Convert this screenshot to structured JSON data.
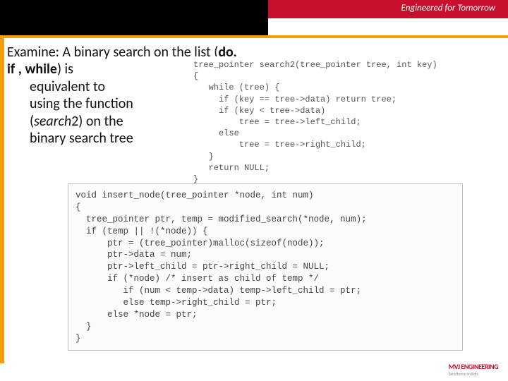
{
  "banner": {
    "tagline": "Engineered for Tomorrow"
  },
  "body": {
    "line1_pre": "Examine: A binary search on the list (",
    "line1_bold": "do, if , while",
    "line1_post": ") is",
    "line2": "equivalent to",
    "line3": "using the function",
    "line4_pre": "(",
    "line4_italic": "search",
    "line4_post": "2) on the",
    "line5": "binary search tree"
  },
  "code1": "tree_pointer search2(tree_pointer tree, int key)\n{\n   while (tree) {\n     if (key == tree->data) return tree;\n     if (key < tree->data)\n         tree = tree->left_child;\n     else\n         tree = tree->right_child;\n   }\n   return NULL;\n}",
  "code2": "void insert_node(tree_pointer *node, int num)\n{\n  tree_pointer ptr, temp = modified_search(*node, num);\n  if (temp || !(*node)) {\n      ptr = (tree_pointer)malloc(sizeof(node));\n      ptr->data = num;\n      ptr->left_child = ptr->right_child = NULL;\n      if (*node) /* insert as child of temp */\n         if (num < temp->data) temp->left_child = ptr;\n         else temp->right_child = ptr;\n      else *node = ptr;\n  }\n}",
  "footer": {
    "brand": "MVJ ENGINEERING",
    "sub": "Excellence in Edu"
  }
}
